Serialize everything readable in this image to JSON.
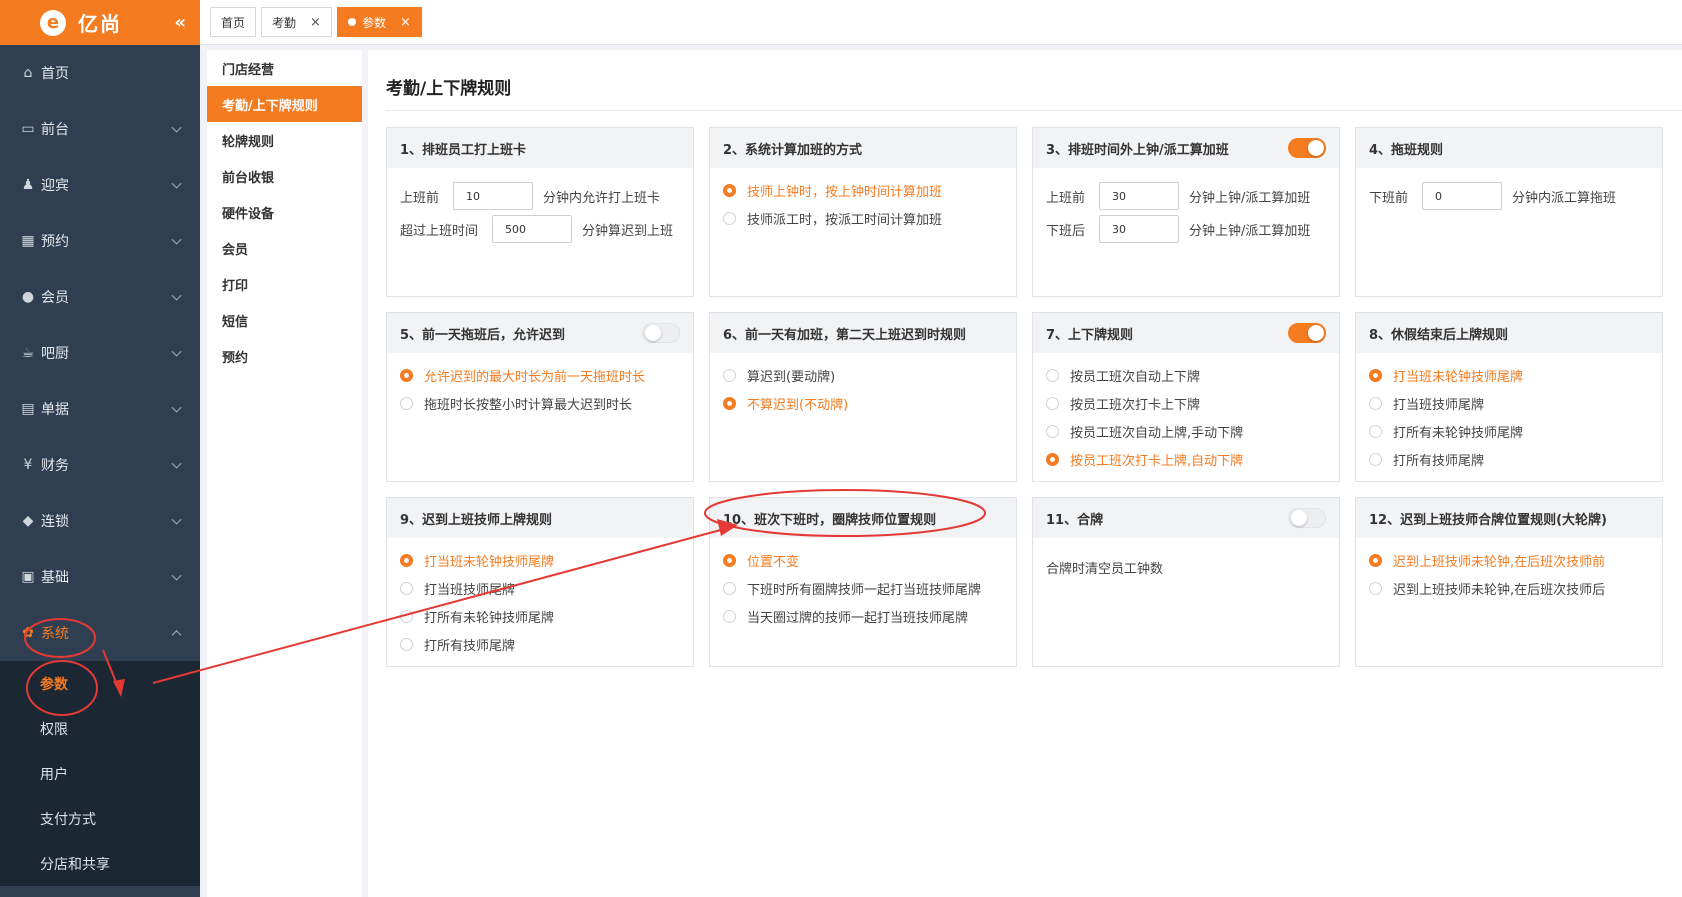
{
  "app": {
    "brand": "亿尚",
    "brand_mark": "e",
    "collapse_icon": "«"
  },
  "colors": {
    "accent": "#f47b20",
    "sidebar": "#2f3e50",
    "sidebar_sub": "#1c2734",
    "annotation": "#e53935"
  },
  "sidebar": {
    "items": [
      {
        "label": "首页",
        "icon": "home-icon",
        "glyph": "⌂"
      },
      {
        "label": "前台",
        "icon": "monitor-icon",
        "glyph": "▭"
      },
      {
        "label": "迎宾",
        "icon": "person-icon",
        "glyph": "♟"
      },
      {
        "label": "预约",
        "icon": "calendar-icon",
        "glyph": "▦"
      },
      {
        "label": "会员",
        "icon": "user-icon",
        "glyph": "●"
      },
      {
        "label": "吧厨",
        "icon": "cup-icon",
        "glyph": "☕"
      },
      {
        "label": "单据",
        "icon": "receipt-icon",
        "glyph": "▤"
      },
      {
        "label": "财务",
        "icon": "money-icon",
        "glyph": "¥"
      },
      {
        "label": "连锁",
        "icon": "cube-icon",
        "glyph": "◆"
      },
      {
        "label": "基础",
        "icon": "grid-icon",
        "glyph": "▣"
      },
      {
        "label": "系统",
        "icon": "gear-icon",
        "glyph": "✿"
      }
    ],
    "sub_items": [
      "参数",
      "权限",
      "用户",
      "支付方式",
      "分店和共享"
    ]
  },
  "tabs": [
    {
      "label": "首页"
    },
    {
      "label": "考勤",
      "close": "×"
    },
    {
      "label": "参数",
      "close": "×"
    }
  ],
  "submenu": [
    "门店经营",
    "考勤/上下牌规则",
    "轮牌规则",
    "前台收银",
    "硬件设备",
    "会员",
    "打印",
    "短信",
    "预约"
  ],
  "page": {
    "title": "考勤/上下牌规则"
  },
  "cards": {
    "c1": {
      "title": "1、排班员工打上班卡",
      "row1": {
        "label": "上班前",
        "value": "10",
        "suffix": "分钟内允许打上班卡"
      },
      "row2": {
        "label": "超过上班时间",
        "value": "500",
        "suffix": "分钟算迟到上班"
      }
    },
    "c2": {
      "title": "2、系统计算加班的方式",
      "options": [
        "技师上钟时，按上钟时间计算加班",
        "技师派工时，按派工时间计算加班"
      ],
      "selected": 0
    },
    "c3": {
      "title": "3、排班时间外上钟/派工算加班",
      "toggle_on": true,
      "row1": {
        "label": "上班前",
        "value": "30",
        "suffix": "分钟上钟/派工算加班"
      },
      "row2": {
        "label": "下班后",
        "value": "30",
        "suffix": "分钟上钟/派工算加班"
      }
    },
    "c4": {
      "title": "4、拖班规则",
      "row1": {
        "label": "下班前",
        "value": "0",
        "suffix": "分钟内派工算拖班"
      }
    },
    "c5": {
      "title": "5、前一天拖班后，允许迟到",
      "toggle_on": false,
      "options": [
        "允许迟到的最大时长为前一天拖班时长",
        "拖班时长按整小时计算最大迟到时长"
      ],
      "selected": 0
    },
    "c6": {
      "title": "6、前一天有加班，第二天上班迟到时规则",
      "options": [
        "算迟到(要动牌)",
        "不算迟到(不动牌)"
      ],
      "selected": 1
    },
    "c7": {
      "title": "7、上下牌规则",
      "toggle_on": true,
      "options": [
        "按员工班次自动上下牌",
        "按员工班次打卡上下牌",
        "按员工班次自动上牌,手动下牌",
        "按员工班次打卡上牌,自动下牌"
      ],
      "selected": 3
    },
    "c8": {
      "title": "8、休假结束后上牌规则",
      "options": [
        "打当班未轮钟技师尾牌",
        "打当班技师尾牌",
        "打所有未轮钟技师尾牌",
        "打所有技师尾牌"
      ],
      "selected": 0
    },
    "c9": {
      "title": "9、迟到上班技师上牌规则",
      "options": [
        "打当班未轮钟技师尾牌",
        "打当班技师尾牌",
        "打所有未轮钟技师尾牌",
        "打所有技师尾牌"
      ],
      "selected": 0
    },
    "c10": {
      "title": "10、班次下班时，圈牌技师位置规则",
      "options": [
        "位置不变",
        "下班时所有圈牌技师一起打当班技师尾牌",
        "当天圈过牌的技师一起打当班技师尾牌"
      ],
      "selected": 0
    },
    "c11": {
      "title": "11、合牌",
      "toggle_on": false,
      "text": "合牌时清空员工钟数"
    },
    "c12": {
      "title": "12、迟到上班技师合牌位置规则(大轮牌)",
      "options": [
        "迟到上班技师未轮钟,在后班次技师前",
        "迟到上班技师未轮钟,在后班次技师后"
      ],
      "selected": 0
    }
  }
}
